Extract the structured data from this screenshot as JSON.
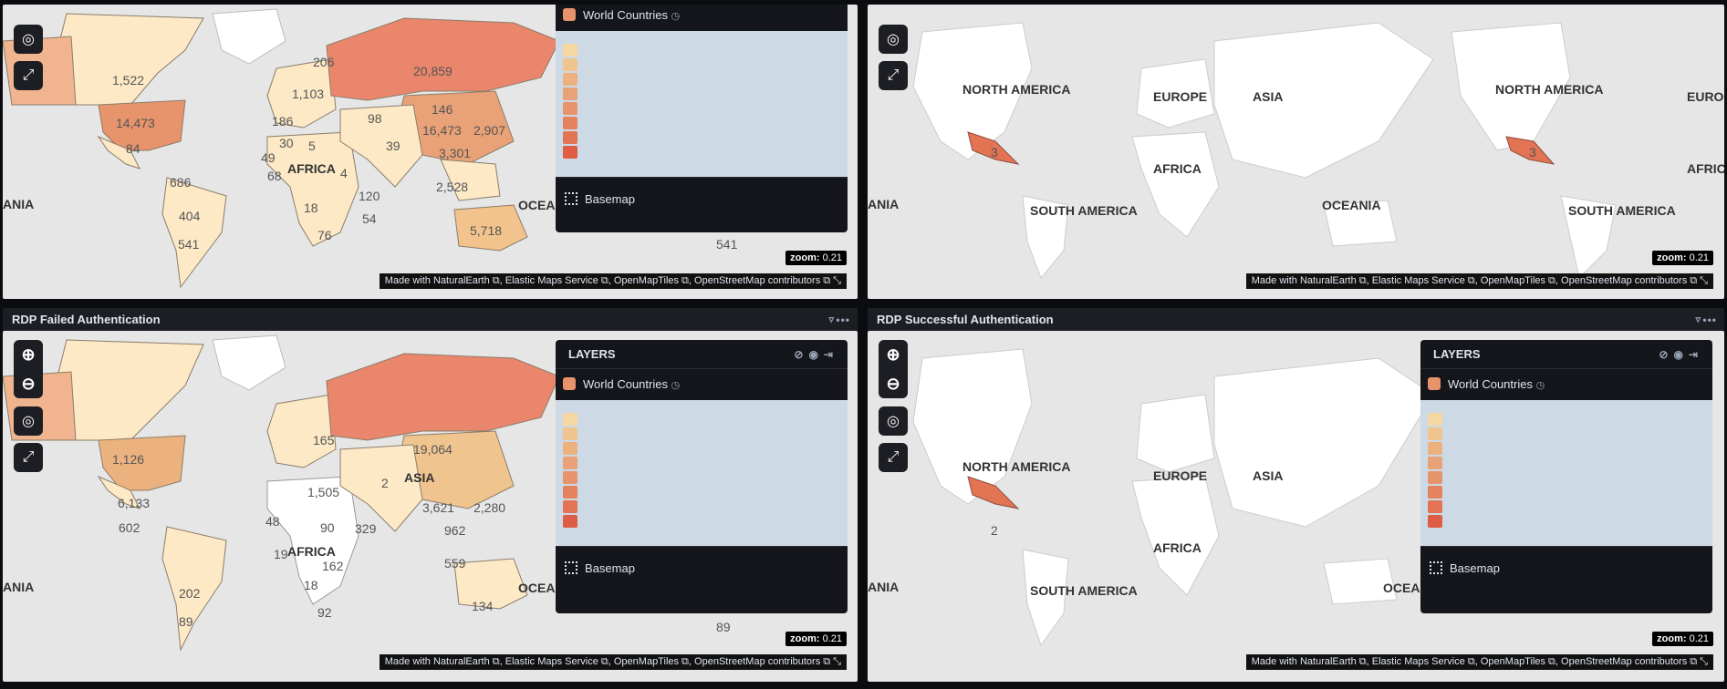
{
  "panels": [
    {
      "title": "",
      "values": [
        "1,522",
        "14,473",
        "20,859",
        "146",
        "16,473",
        "5,718",
        "3,301",
        "2,907",
        "206",
        "30",
        "120",
        "54",
        "404",
        "541",
        "686",
        "49",
        "68",
        "76",
        "18",
        "84",
        "4",
        "98",
        "2,528",
        "541",
        "186",
        "1,103",
        "5",
        "39"
      ],
      "zoom_label": "zoom:",
      "zoom_value": "0.21",
      "continents": [
        "ANIA",
        "AFRICA",
        "OCEAN"
      ]
    },
    {
      "title": "",
      "values": [
        "3",
        "3"
      ],
      "zoom_label": "zoom:",
      "zoom_value": "0.21",
      "continents": [
        "NORTH AMERICA",
        "EUROPE",
        "ASIA",
        "AFRICA",
        "SOUTH AMERICA",
        "OCEANIA",
        "NORTH AMERICA",
        "SOUTH AMERICA",
        "ANIA",
        "EUROP",
        "AFRIC"
      ]
    },
    {
      "title": "RDP Failed Authentication",
      "values": [
        "1,126",
        "6,133",
        "19,064",
        "2",
        "3,621",
        "2,280",
        "134",
        "602",
        "202",
        "89",
        "162",
        "90",
        "329",
        "962",
        "1,505",
        "48",
        "19",
        "18",
        "92",
        "559",
        "89",
        "165",
        "ASIA"
      ],
      "zoom_label": "zoom:",
      "zoom_value": "0.21",
      "continents": [
        "ANIA",
        "AFRICA",
        "OCEAN"
      ]
    },
    {
      "title": "RDP Successful Authentication",
      "values": [
        "2"
      ],
      "zoom_label": "zoom:",
      "zoom_value": "0.21",
      "continents": [
        "NORTH AMERICA",
        "EUROPE",
        "ASIA",
        "AFRICA",
        "SOUTH AMERICA",
        "ANIA",
        "OCEAN"
      ]
    }
  ],
  "legend": {
    "header": "LAYERS",
    "layer_name": "World Countries",
    "basemap": "Basemap"
  },
  "attribution": {
    "a": "Made with NaturalEarth",
    "b": "Elastic Maps Service",
    "c": "OpenMapTiles",
    "d": "OpenStreetMap contributors"
  },
  "colors": {
    "scale": [
      "#f5d7a1",
      "#f0c48e",
      "#ebb27f",
      "#e9a277",
      "#e7936b",
      "#e5835f",
      "#e27353",
      "#df5c45"
    ]
  }
}
